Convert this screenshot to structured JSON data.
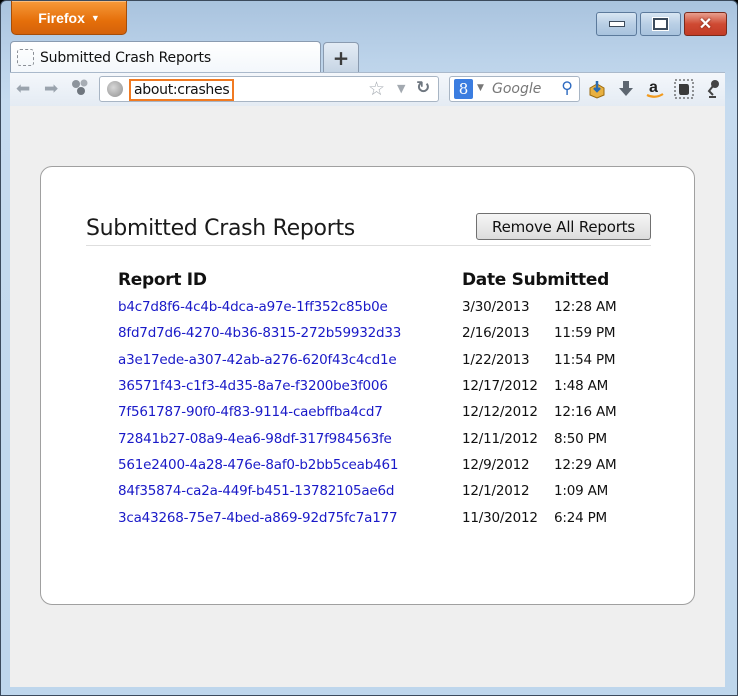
{
  "window": {
    "app_menu_label": "Firefox",
    "controls": {
      "minimize": "minimize",
      "maximize": "maximize",
      "close": "close"
    }
  },
  "tabs": [
    {
      "label": "Submitted Crash Reports",
      "active": true
    }
  ],
  "new_tab_label": "+",
  "navbar": {
    "url": "about:crashes",
    "search": {
      "engine_glyph": "8",
      "placeholder": "Google"
    },
    "addons": [
      "addon-box-icon",
      "download-icon",
      "amazon-icon",
      "evernote-icon",
      "lamp-icon"
    ]
  },
  "page": {
    "title": "Submitted Crash Reports",
    "remove_all_label": "Remove All Reports",
    "columns": {
      "report_id": "Report ID",
      "date_submitted": "Date Submitted"
    },
    "reports": [
      {
        "id": "b4c7d8f6-4c4b-4dca-a97e-1ff352c85b0e",
        "date": "3/30/2013",
        "time": "12:28 AM"
      },
      {
        "id": "8fd7d7d6-4270-4b36-8315-272b59932d33",
        "date": "2/16/2013",
        "time": "11:59 PM"
      },
      {
        "id": "a3e17ede-a307-42ab-a276-620f43c4cd1e",
        "date": "1/22/2013",
        "time": "11:54 PM"
      },
      {
        "id": "36571f43-c1f3-4d35-8a7e-f3200be3f006",
        "date": "12/17/2012",
        "time": "1:48 AM"
      },
      {
        "id": "7f561787-90f0-4f83-9114-caebffba4cd7",
        "date": "12/12/2012",
        "time": "12:16 AM"
      },
      {
        "id": "72841b27-08a9-4ea6-98df-317f984563fe",
        "date": "12/11/2012",
        "time": "8:50 PM"
      },
      {
        "id": "561e2400-4a28-476e-8af0-b2bb5ceab461",
        "date": "12/9/2012",
        "time": "12:29 AM"
      },
      {
        "id": "84f35874-ca2a-449f-b451-13782105ae6d",
        "date": "12/1/2012",
        "time": "1:09 AM"
      },
      {
        "id": "3ca43268-75e7-4bed-a869-92d75fc7a177",
        "date": "11/30/2012",
        "time": "6:24 PM"
      }
    ]
  },
  "colors": {
    "firefox_orange": "#e56f0a",
    "link_blue": "#1a1ac8",
    "url_highlight": "#f07a22",
    "close_red": "#cf4a33"
  }
}
